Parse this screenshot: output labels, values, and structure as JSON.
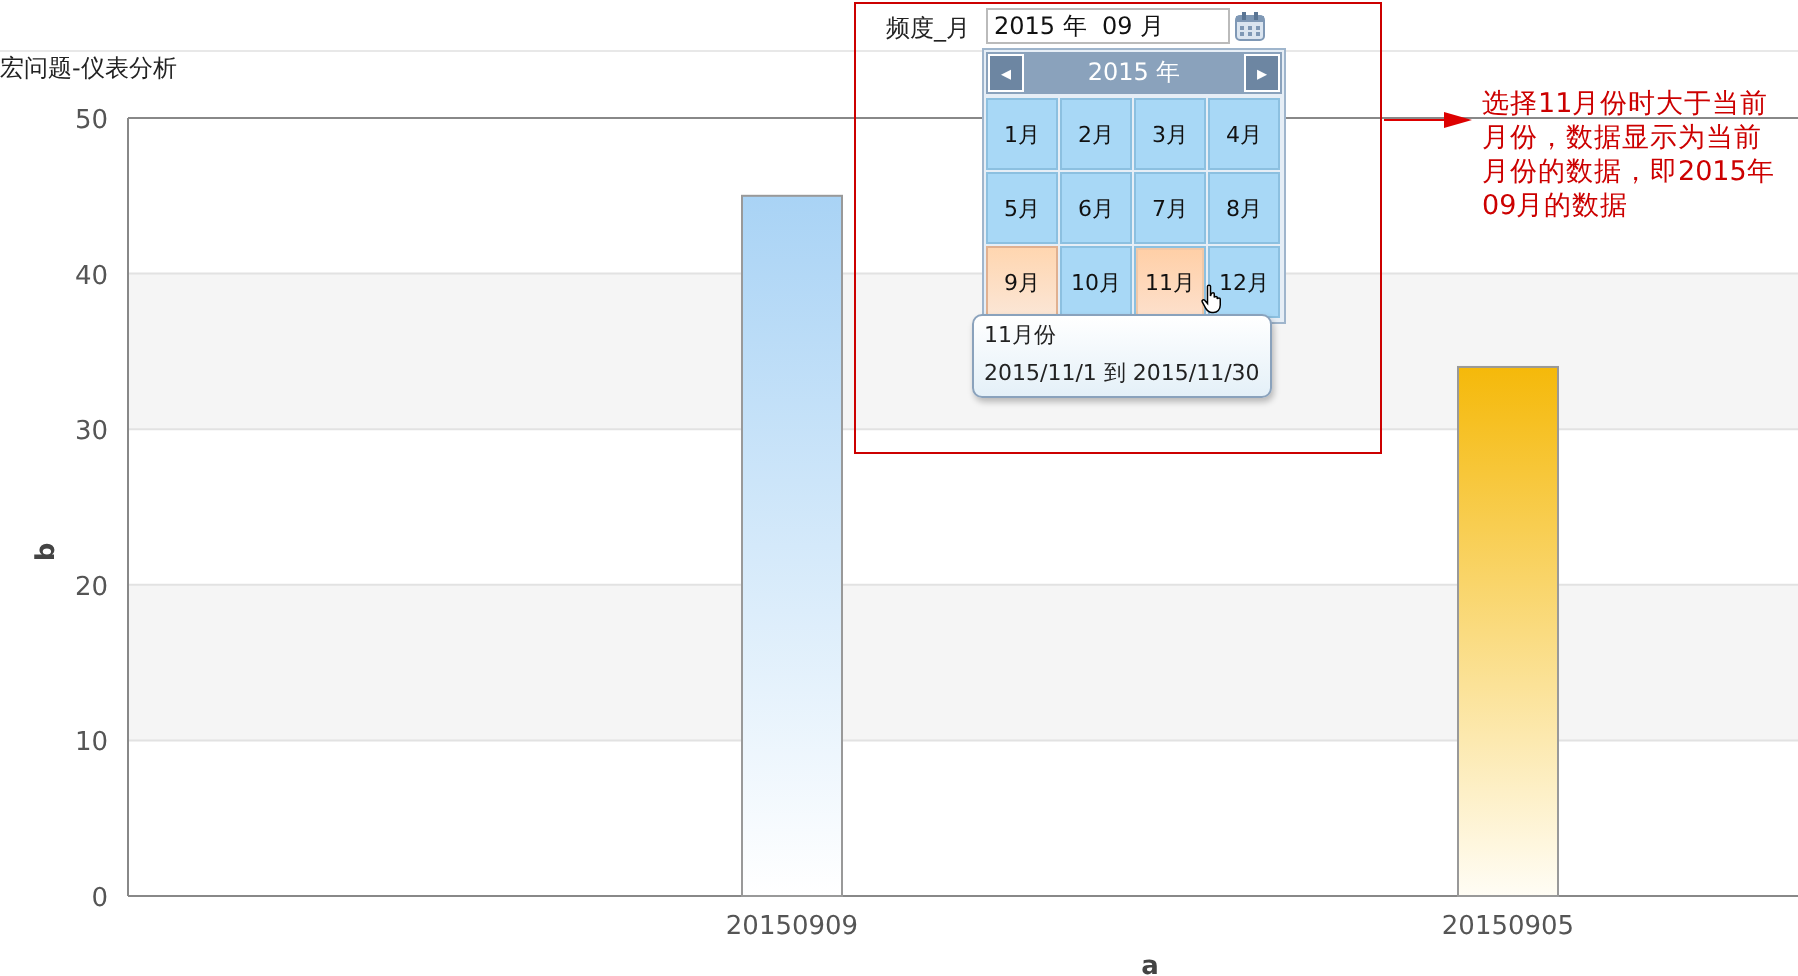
{
  "page_title": "宏问题-仪表分析",
  "filter": {
    "label": "频度_月",
    "value": "2015 年  09 月"
  },
  "month_picker": {
    "year": "2015 年",
    "prev": "◂",
    "next": "▸",
    "months": [
      {
        "label": "1月",
        "selected": false,
        "hovered": false
      },
      {
        "label": "2月",
        "selected": false,
        "hovered": false
      },
      {
        "label": "3月",
        "selected": false,
        "hovered": false
      },
      {
        "label": "4月",
        "selected": false,
        "hovered": false
      },
      {
        "label": "5月",
        "selected": false,
        "hovered": false
      },
      {
        "label": "6月",
        "selected": false,
        "hovered": false
      },
      {
        "label": "7月",
        "selected": false,
        "hovered": false
      },
      {
        "label": "8月",
        "selected": false,
        "hovered": false
      },
      {
        "label": "9月",
        "selected": true,
        "hovered": false
      },
      {
        "label": "10月",
        "selected": false,
        "hovered": false
      },
      {
        "label": "11月",
        "selected": false,
        "hovered": true
      },
      {
        "label": "12月",
        "selected": false,
        "hovered": false
      }
    ]
  },
  "tooltip": {
    "title": "11月份",
    "range": "2015/11/1 到  2015/11/30"
  },
  "annotation": {
    "text": "选择11月份时大于当前月份，数据显示为当前月份的数据，即2015年09月的数据"
  },
  "chart": {
    "chart_data": {
      "type": "bar",
      "xlabel": "a",
      "ylabel": "b",
      "categories": [
        "20150909",
        "20150905"
      ],
      "series": [
        {
          "values": [
            45,
            34
          ]
        }
      ],
      "grid": true,
      "ylim": [
        0,
        50
      ],
      "yticks": [
        0,
        10,
        20,
        30,
        40,
        50
      ]
    }
  }
}
